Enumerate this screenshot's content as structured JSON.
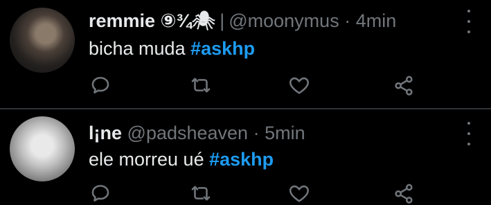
{
  "tweets": [
    {
      "display_name": "remmie ⑨¾🕷",
      "separator": "|",
      "handle": "@moonymus",
      "dot": "·",
      "time": "4min",
      "text": "bicha muda",
      "hashtag": "#askhp"
    },
    {
      "display_name": "l¡ne",
      "separator": "",
      "handle": "@padsheaven",
      "dot": "·",
      "time": "5min",
      "text": "ele morreu ué",
      "hashtag": "#askhp"
    }
  ],
  "colors": {
    "background": "#000000",
    "text": "#e7e9ea",
    "muted": "#71767b",
    "hashtag": "#1d9bf0",
    "divider": "#2f3336"
  },
  "icons": [
    "reply-icon",
    "retweet-icon",
    "like-icon",
    "share-icon",
    "more-icon"
  ]
}
